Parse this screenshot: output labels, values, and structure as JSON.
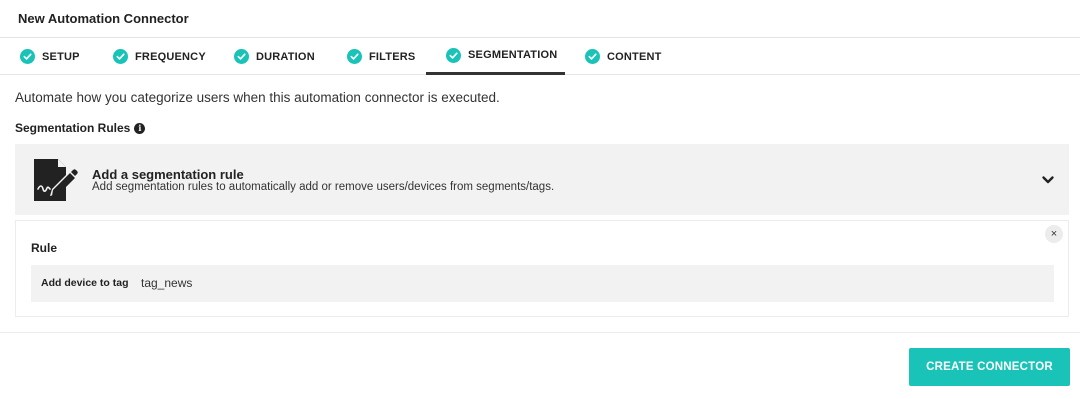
{
  "window": {
    "title": "New Automation Connector"
  },
  "tabs": [
    {
      "label": "SETUP",
      "status": "complete"
    },
    {
      "label": "FREQUENCY",
      "status": "complete"
    },
    {
      "label": "DURATION",
      "status": "complete"
    },
    {
      "label": "FILTERS",
      "status": "complete"
    },
    {
      "label": "SEGMENTATION",
      "status": "complete",
      "active": true
    },
    {
      "label": "CONTENT",
      "status": "complete"
    }
  ],
  "main": {
    "description": "Automate how you categorize users when this automation connector is executed.",
    "segmentation_heading": "Segmentation Rules",
    "add_rule_panel": {
      "title": "Add a segmentation rule",
      "subtitle": "Add segmentation rules to automatically add or remove users/devices from segments/tags."
    },
    "rule_card": {
      "label": "Rule",
      "close_glyph": "×",
      "row": {
        "key": "Add device to tag",
        "value": "tag_news"
      }
    }
  },
  "footer": {
    "create_label": "CREATE CONNECTOR"
  },
  "colors": {
    "accent": "#19c3b7",
    "panel_bg": "#f2f2f3"
  },
  "icons": [
    "check-circle-icon",
    "info-icon",
    "document-edit-icon",
    "chevron-down-icon",
    "close-icon"
  ]
}
